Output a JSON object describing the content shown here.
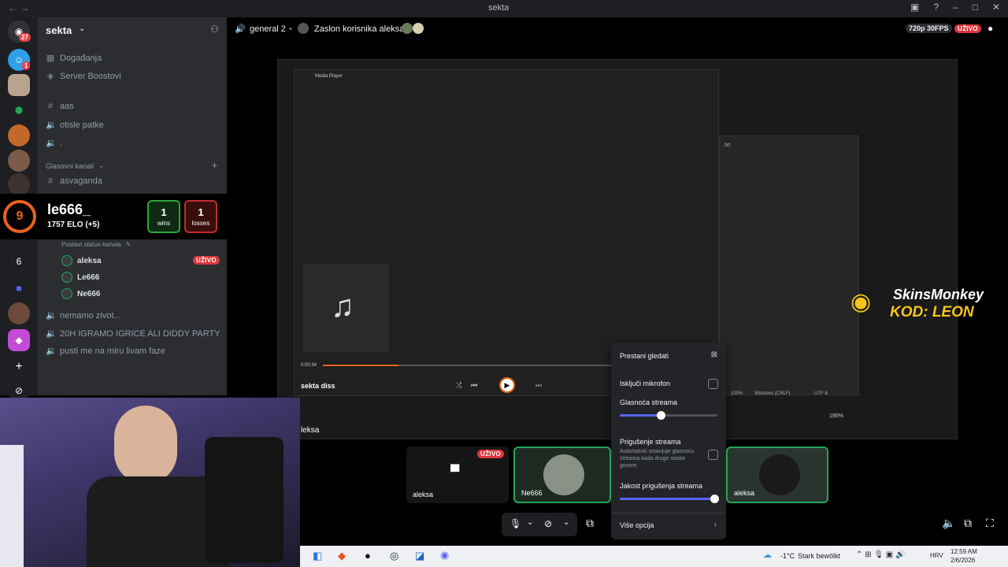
{
  "window": {
    "title": "sekta"
  },
  "rail": {
    "home_badge": "27",
    "server2_badge": "1",
    "server_num": "6"
  },
  "sidebar": {
    "server_name": "sekta",
    "events": "Događanja",
    "boosts": "Server Boostovi",
    "channels": [
      "aas",
      "otisle patke",
      "."
    ],
    "voice_category": "Glasovni kanali",
    "channel_asvaganda": "asvaganda",
    "status_hint": "Postavi status kanala",
    "voice_users": [
      "aleksa",
      "Le666",
      "Ne666"
    ],
    "live_badge": "UŽIVO",
    "more_channels": [
      "nemamo zivot...",
      "20H IGRAMO IGRICE ALI DIDDY PARTY",
      "pusti me na miru livam faze"
    ]
  },
  "elo": {
    "level": "9",
    "name": "le666_",
    "elo": "1757 ELO (+5)",
    "wins": "1",
    "wins_label": "wins",
    "losses": "1",
    "losses_label": "losses"
  },
  "header": {
    "channel": "general 2",
    "stream_title": "Zaslon korisnika aleksa",
    "quality": "720p 30FPS",
    "live": "UŽIVO"
  },
  "media_player": {
    "title": "Media Player",
    "track": "sekta diss",
    "time": "0:00:34"
  },
  "notepad": {
    "zoom": "100%",
    "eol": "Windows (CRLF)",
    "enc": "UTF-8",
    "zoom2": "195%"
  },
  "popover": {
    "stop": "Prestani gledati",
    "mute_mic": "Isključi mikrofon",
    "volume": "Glasnoća streama",
    "volume_value": 0.42,
    "ducking": "Prigušenje streama",
    "ducking_desc": "Automatski smanjuje glasnoću streama kada druge osobe govore.",
    "ducking_strength": "Jakost prigušenja streama",
    "ducking_value": 0.97,
    "more": "Više opcija"
  },
  "tiles": [
    {
      "name": "aleksa",
      "live": "UŽIVO"
    },
    {
      "name": "Ne666"
    },
    {
      "name": "aleksa"
    }
  ],
  "stream_user": "leksa",
  "sponsor": {
    "brand": "SkinsMonkey",
    "code": "KOD: LEON"
  },
  "taskbar": {
    "weather": "-1°C",
    "weather_desc": "Stark bewölkt",
    "lang": "HRV",
    "time": "12:59 AM",
    "date": "2/6/2026"
  }
}
